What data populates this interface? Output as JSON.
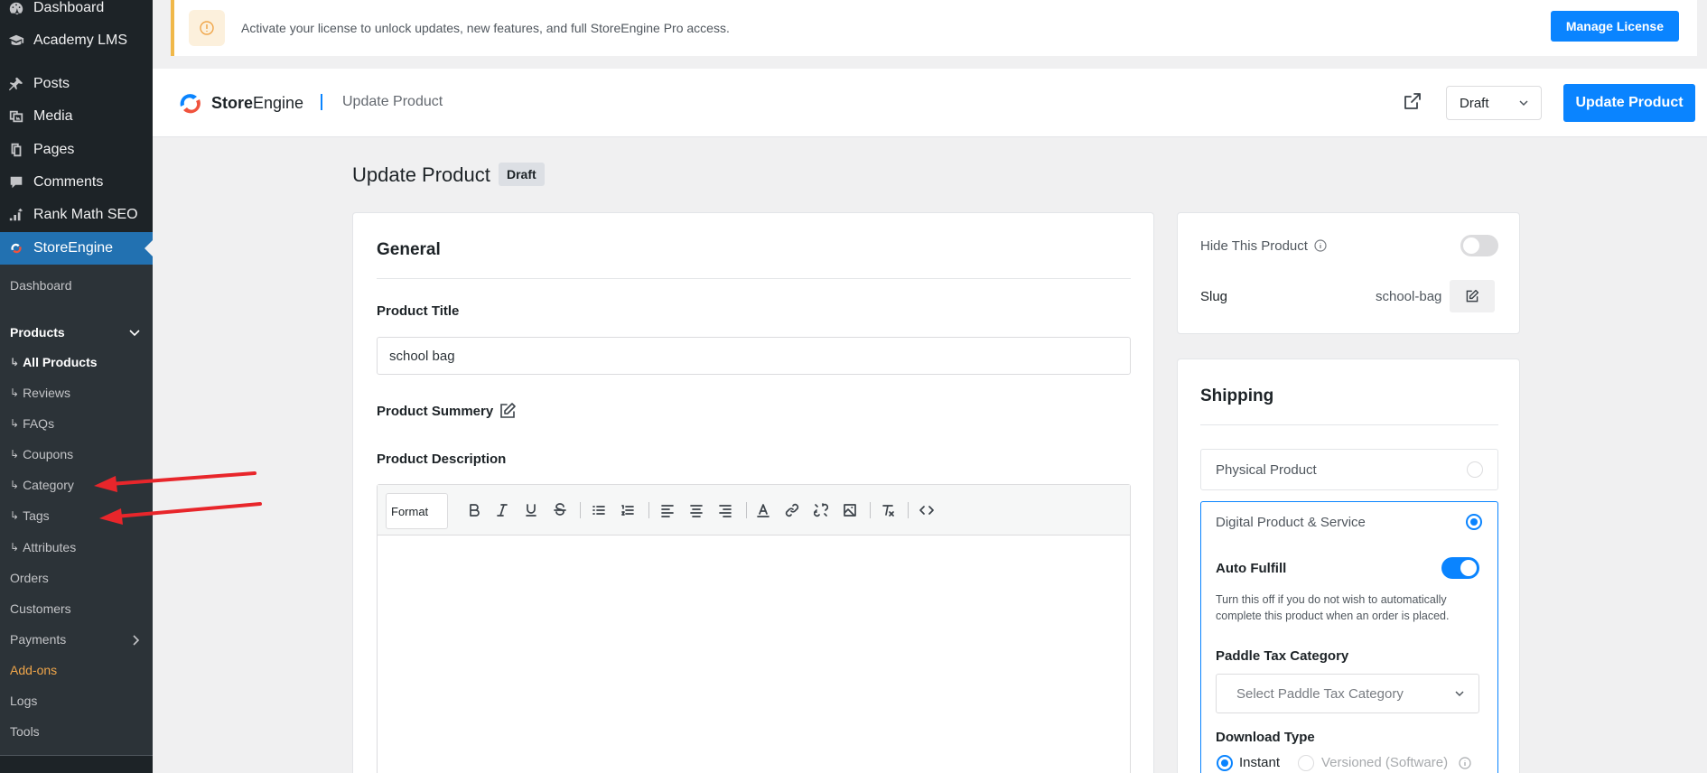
{
  "sidebar": {
    "menu": [
      {
        "label": "Dashboard",
        "icon": "dashboard-icon"
      },
      {
        "label": "Academy LMS",
        "icon": "academy-icon"
      },
      {
        "label": "Posts",
        "icon": "pin-icon"
      },
      {
        "label": "Media",
        "icon": "media-icon"
      },
      {
        "label": "Pages",
        "icon": "pages-icon"
      },
      {
        "label": "Comments",
        "icon": "comments-icon"
      },
      {
        "label": "Rank Math SEO",
        "icon": "rank-math-icon"
      },
      {
        "label": "StoreEngine",
        "icon": "storeengine-icon"
      }
    ],
    "submenu": {
      "dashboard": "Dashboard",
      "products": "Products",
      "all_products": "All Products",
      "reviews": "Reviews",
      "faqs": "FAQs",
      "coupons": "Coupons",
      "category": "Category",
      "tags": "Tags",
      "attributes": "Attributes",
      "orders": "Orders",
      "customers": "Customers",
      "payments": "Payments",
      "addons": "Add-ons",
      "logs": "Logs",
      "tools": "Tools"
    },
    "sub_arrow": "↳"
  },
  "notice": {
    "text": "Activate your license to unlock updates, new features, and full StoreEngine Pro access.",
    "button": "Manage License"
  },
  "header": {
    "brand_bold": "Store",
    "brand_rest": "Engine",
    "title": "Update Product",
    "status": "Draft",
    "update_button": "Update Product"
  },
  "page": {
    "title": "Update Product",
    "badge": "Draft"
  },
  "general": {
    "heading": "General",
    "product_title_label": "Product Title",
    "product_title_value": "school bag",
    "summary_label": "Product Summery",
    "description_label": "Product Description",
    "format_label": "Format"
  },
  "side": {
    "hide_label": "Hide This Product",
    "slug_label": "Slug",
    "slug_value": "school-bag"
  },
  "shipping": {
    "heading": "Shipping",
    "physical": "Physical Product",
    "digital": "Digital Product & Service",
    "auto_fulfill": "Auto Fulfill",
    "help": "Turn this off if you do not wish to automatically complete this product when an order is placed.",
    "paddle_label": "Paddle Tax Category",
    "paddle_placeholder": "Select Paddle Tax Category",
    "download_type": "Download Type",
    "instant": "Instant",
    "versioned": "Versioned (Software)"
  },
  "colors": {
    "accent": "#0a84ff",
    "wp_active": "#2271b1",
    "notice_border": "#f0b849",
    "arrow": "#e8262b"
  }
}
